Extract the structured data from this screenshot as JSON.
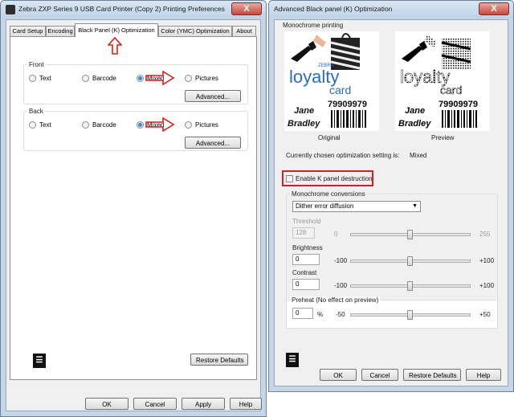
{
  "left_window": {
    "title": "Zebra ZXP Series 9 USB Card Printer (Copy 2) Printing Preferences",
    "close_label": "X",
    "tabs": [
      {
        "label": "Card Setup"
      },
      {
        "label": "Encoding"
      },
      {
        "label": "Black Panel (K) Optimization"
      },
      {
        "label": "Color (YMC) Optimization"
      },
      {
        "label": "About"
      }
    ],
    "front": {
      "label": "Front",
      "options": [
        "Text",
        "Barcode",
        "Mixed",
        "Pictures"
      ],
      "selected": "Mixed",
      "advanced_label": "Advanced..."
    },
    "back": {
      "label": "Back",
      "options": [
        "Text",
        "Barcode",
        "Mixed",
        "Pictures"
      ],
      "selected": "Mixed",
      "advanced_label": "Advanced..."
    },
    "restore_label": "Restore Defaults",
    "buttons": {
      "ok": "OK",
      "cancel": "Cancel",
      "apply": "Apply",
      "help": "Help"
    }
  },
  "right_window": {
    "title": "Advanced Black panel (K) Optimization",
    "close_label": "X",
    "monochrome_printing_label": "Monochrome printing",
    "original_caption": "Original",
    "preview_caption": "Preview",
    "card": {
      "brand": "ZEBRA",
      "loyalty": "loyalty",
      "card_word": "card",
      "number": "79909979",
      "first_name": "Jane",
      "last_name": "Bradley"
    },
    "current_setting_label": "Currently chosen optimization setting is:",
    "current_setting_value": "Mixed",
    "enable_k_label": "Enable K panel destruction",
    "mono_conversions_label": "Monochrome conversions",
    "conversion_value": "Dither error diffusion",
    "threshold": {
      "label": "Threshold",
      "value": "128",
      "min": "0",
      "max": "255",
      "level": 128,
      "range": [
        0,
        255
      ]
    },
    "brightness": {
      "label": "Brightness",
      "value": "0",
      "min": "-100",
      "max": "+100",
      "level": 0,
      "range": [
        -100,
        100
      ]
    },
    "contrast": {
      "label": "Contrast",
      "value": "0",
      "min": "-100",
      "max": "+100",
      "level": 0,
      "range": [
        -100,
        100
      ]
    },
    "preheat": {
      "label": "Preheat (No effect on preview)",
      "value": "0",
      "unit": "%",
      "min": "-50",
      "max": "+50",
      "level": 0,
      "range": [
        -50,
        50
      ]
    },
    "buttons": {
      "ok": "OK",
      "cancel": "Cancel",
      "restore": "Restore Defaults",
      "help": "Help"
    }
  },
  "colors": {
    "annotation": "#d81e1e",
    "accent": "#1b5fa3",
    "loyalty_blue": "#2a6db5"
  }
}
